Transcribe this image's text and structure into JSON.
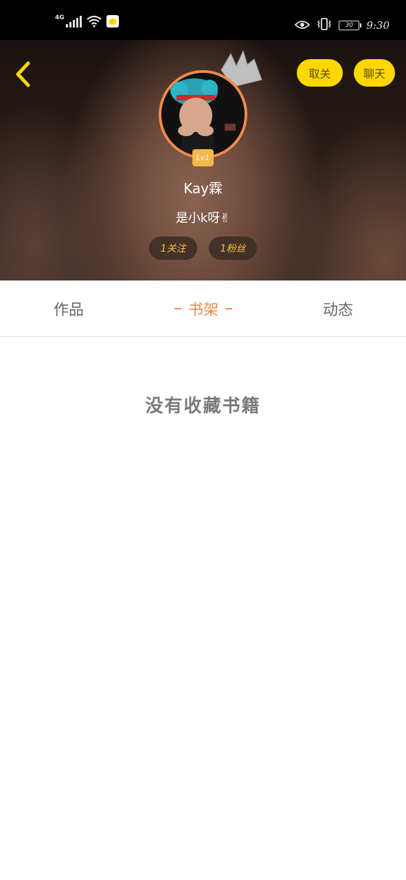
{
  "status_bar": {
    "network": "4G",
    "battery": "30",
    "time": "9:30"
  },
  "header": {
    "unfollow_label": "取关",
    "chat_label": "聊天",
    "level": "Lv1",
    "user_name": "Kay霖",
    "bio": "是小k呀✌",
    "following": "1关注",
    "followers": "1粉丝"
  },
  "tabs": [
    {
      "label": "作品",
      "selected": false
    },
    {
      "label": "书架",
      "selected": true
    },
    {
      "label": "动态",
      "selected": false
    }
  ],
  "content": {
    "empty_message": "没有收藏书籍"
  },
  "colors": {
    "accent": "#f08a4b",
    "button_yellow": "#ffd700",
    "chip_text": "#f2c43a"
  },
  "icons": {
    "back": "chevron-left-icon",
    "crown": "crown-icon"
  }
}
